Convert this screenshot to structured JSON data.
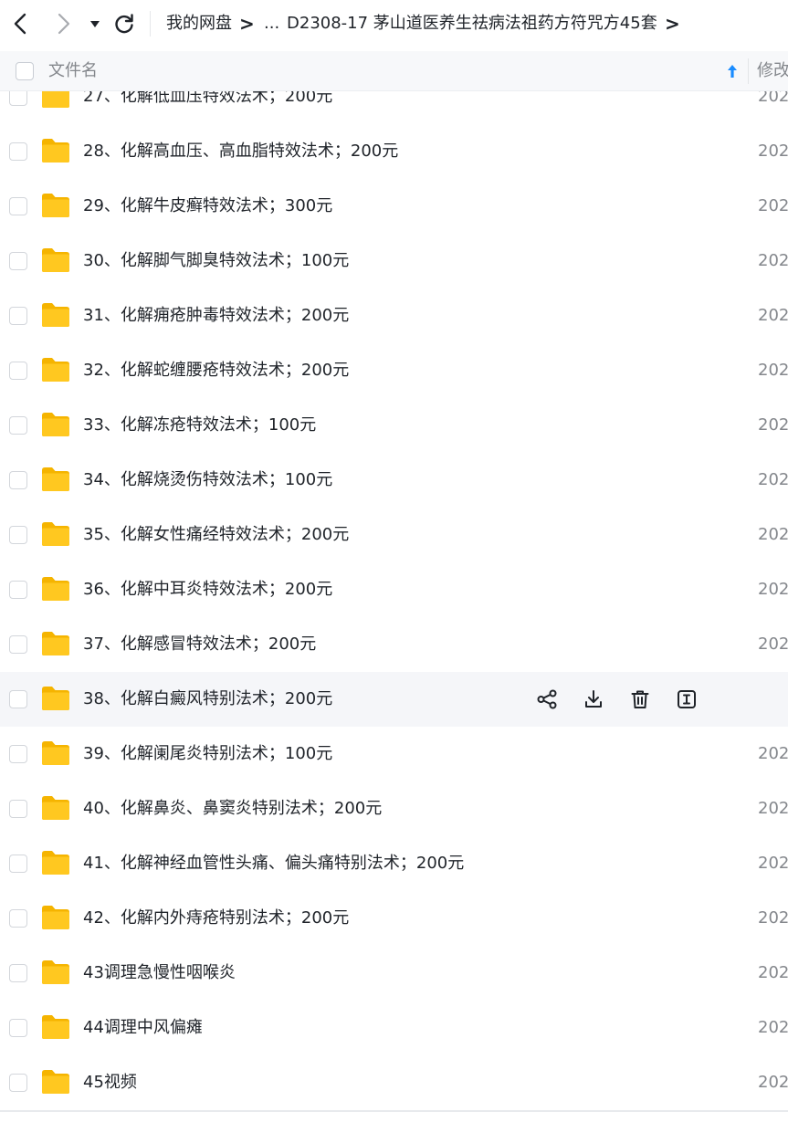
{
  "nav": {
    "back_icon": "chevron-left-icon",
    "forward_icon": "chevron-right-icon",
    "dropdown_icon": "caret-down-icon",
    "refresh_icon": "refresh-icon"
  },
  "breadcrumb": {
    "home": "我的网盘",
    "separator": ">",
    "ellipsis": "...",
    "current": "D2308-17 茅山道医养生祛病法祖药方符咒方45套"
  },
  "header": {
    "name_label": "文件名",
    "modified_label": "修改",
    "sort_icon": "sort-ascending-arrow-icon"
  },
  "colors": {
    "folder_yellow": "#FFC820",
    "folder_back": "#F5B400",
    "sort_blue": "#1a8cff",
    "hover_row": "#f5f6f9"
  },
  "files": [
    {
      "name": "27、化解低血压特效法术；200元",
      "date": "202"
    },
    {
      "name": "28、化解高血压、高血脂特效法术；200元",
      "date": "202"
    },
    {
      "name": "29、化解牛皮癣特效法术；300元",
      "date": "202"
    },
    {
      "name": "30、化解脚气脚臭特效法术；100元",
      "date": "202"
    },
    {
      "name": "31、化解痈疮肿毒特效法术；200元",
      "date": "202"
    },
    {
      "name": "32、化解蛇缠腰疮特效法术；200元",
      "date": "202"
    },
    {
      "name": "33、化解冻疮特效法术；100元",
      "date": "202"
    },
    {
      "name": "34、化解烧烫伤特效法术；100元",
      "date": "202"
    },
    {
      "name": "35、化解女性痛经特效法术；200元",
      "date": "202"
    },
    {
      "name": "36、化解中耳炎特效法术；200元",
      "date": "202"
    },
    {
      "name": "37、化解感冒特效法术；200元",
      "date": "202"
    },
    {
      "name": "38、化解白癜风特别法术；200元",
      "date": "",
      "hovered": true
    },
    {
      "name": "39、化解阑尾炎特别法术；100元",
      "date": "202"
    },
    {
      "name": "40、化解鼻炎、鼻窦炎特别法术；200元",
      "date": "202"
    },
    {
      "name": "41、化解神经血管性头痛、偏头痛特别法术；200元",
      "date": "202"
    },
    {
      "name": "42、化解内外痔疮特别法术；200元",
      "date": "202"
    },
    {
      "name": "43调理急慢性咽喉炎",
      "date": "202"
    },
    {
      "name": "44调理中风偏瘫",
      "date": "202"
    },
    {
      "name": "45视频",
      "date": "202"
    }
  ],
  "row_actions": [
    "share-icon",
    "download-icon",
    "delete-icon",
    "rename-icon"
  ]
}
